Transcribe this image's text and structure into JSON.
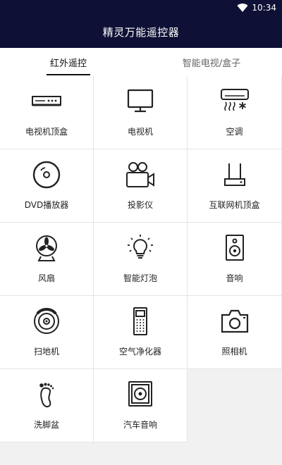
{
  "status": {
    "time": "10:34",
    "wifi_icon": "wifi-icon"
  },
  "app": {
    "title": "精灵万能遥控器"
  },
  "tabs": [
    {
      "label": "红外遥控",
      "active": true
    },
    {
      "label": "智能电视/盒子",
      "active": false
    }
  ],
  "devices": [
    {
      "label": "电视机顶盒",
      "icon": "set-top-box-icon"
    },
    {
      "label": "电视机",
      "icon": "tv-icon"
    },
    {
      "label": "空调",
      "icon": "air-conditioner-icon"
    },
    {
      "label": "DVD播放器",
      "icon": "dvd-icon"
    },
    {
      "label": "投影仪",
      "icon": "projector-icon"
    },
    {
      "label": "互联网机顶盒",
      "icon": "internet-box-icon"
    },
    {
      "label": "风扇",
      "icon": "fan-icon"
    },
    {
      "label": "智能灯泡",
      "icon": "light-bulb-icon"
    },
    {
      "label": "音响",
      "icon": "speaker-icon"
    },
    {
      "label": "扫地机",
      "icon": "robot-vacuum-icon"
    },
    {
      "label": "空气净化器",
      "icon": "air-purifier-icon"
    },
    {
      "label": "照相机",
      "icon": "camera-icon"
    },
    {
      "label": "洗脚盆",
      "icon": "foot-bath-icon"
    },
    {
      "label": "汽车音响",
      "icon": "car-audio-icon"
    }
  ],
  "colors": {
    "header": "#0e1035",
    "background": "#f1f1f1",
    "icon": "#222222"
  }
}
